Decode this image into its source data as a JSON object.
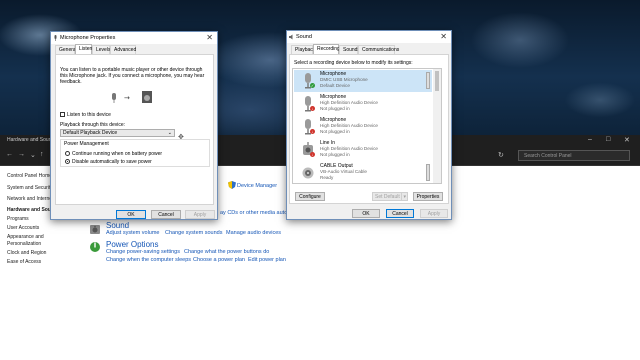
{
  "control_panel": {
    "window_title": "Hardware and Sound",
    "search_placeholder": "Search Control Panel",
    "sidebar": [
      {
        "label": "Control Panel Home",
        "bold": false
      },
      {
        "label": "System and Security",
        "bold": false
      },
      {
        "label": "Network and Internet",
        "bold": false
      },
      {
        "label": "Hardware and Sound",
        "bold": true
      },
      {
        "label": "Programs",
        "bold": false
      },
      {
        "label": "User Accounts",
        "bold": false
      },
      {
        "label": "Appearance and Personalization",
        "bold": false
      },
      {
        "label": "Clock and Region",
        "bold": false
      },
      {
        "label": "Ease of Access",
        "bold": false
      }
    ],
    "device_manager_link": "Device Manager",
    "autoplay_link_partial": "ay CDs or other media autom",
    "sound": {
      "heading": "Sound",
      "links": [
        "Adjust system volume",
        "Change system sounds",
        "Manage audio devices"
      ]
    },
    "power": {
      "heading": "Power Options",
      "links_row1": [
        "Change power-saving settings",
        "Change what the power buttons do"
      ],
      "links_row2": [
        "Change when the computer sleeps",
        "Choose a power plan",
        "Edit power plan"
      ]
    }
  },
  "mic_props": {
    "title": "Microphone Properties",
    "tabs": [
      "General",
      "Listen",
      "Levels",
      "Advanced"
    ],
    "active_tab": "Listen",
    "description": [
      "You can listen to a portable music player or other device through",
      "this Microphone jack. If you connect a microphone, you may hear",
      "feedback."
    ],
    "listen_checkbox": "Listen to this device",
    "playback_label": "Playback through this device:",
    "playback_value": "Default Playback Device",
    "power_group": "Power Management",
    "radio_continue": "Continue running when on battery power",
    "radio_disable": "Disable automatically to save power",
    "buttons": {
      "ok": "OK",
      "cancel": "Cancel",
      "apply": "Apply"
    }
  },
  "sound_dialog": {
    "title": "Sound",
    "tabs": [
      "Playback",
      "Recording",
      "Sounds",
      "Communications"
    ],
    "active_tab": "Recording",
    "instruction": "Select a recording device below to modify its settings:",
    "devices": [
      {
        "name": "Microphone",
        "sub1": "DMIC USB Microphone",
        "sub2": "Default Device",
        "status": "default",
        "selected": true
      },
      {
        "name": "Microphone",
        "sub1": "High Definition Audio Device",
        "sub2": "Not plugged in",
        "status": "unplugged",
        "selected": false
      },
      {
        "name": "Microphone",
        "sub1": "High Definition Audio Device",
        "sub2": "Not plugged in",
        "status": "unplugged",
        "selected": false
      },
      {
        "name": "Line In",
        "sub1": "High Definition Audio Device",
        "sub2": "Not plugged in",
        "status": "unplugged",
        "selected": false
      },
      {
        "name": "CABLE Output",
        "sub1": "VB-Audio Virtual Cable",
        "sub2": "Ready",
        "status": "ready",
        "selected": false
      }
    ],
    "buttons": {
      "configure": "Configure",
      "set_default": "Set Default",
      "properties": "Properties",
      "ok": "OK",
      "cancel": "Cancel",
      "apply": "Apply"
    }
  },
  "colors": {
    "accent": "#0078d7",
    "link": "#1556b6",
    "default_badge": "#2e9a3a",
    "unplugged_badge": "#d0342c"
  }
}
